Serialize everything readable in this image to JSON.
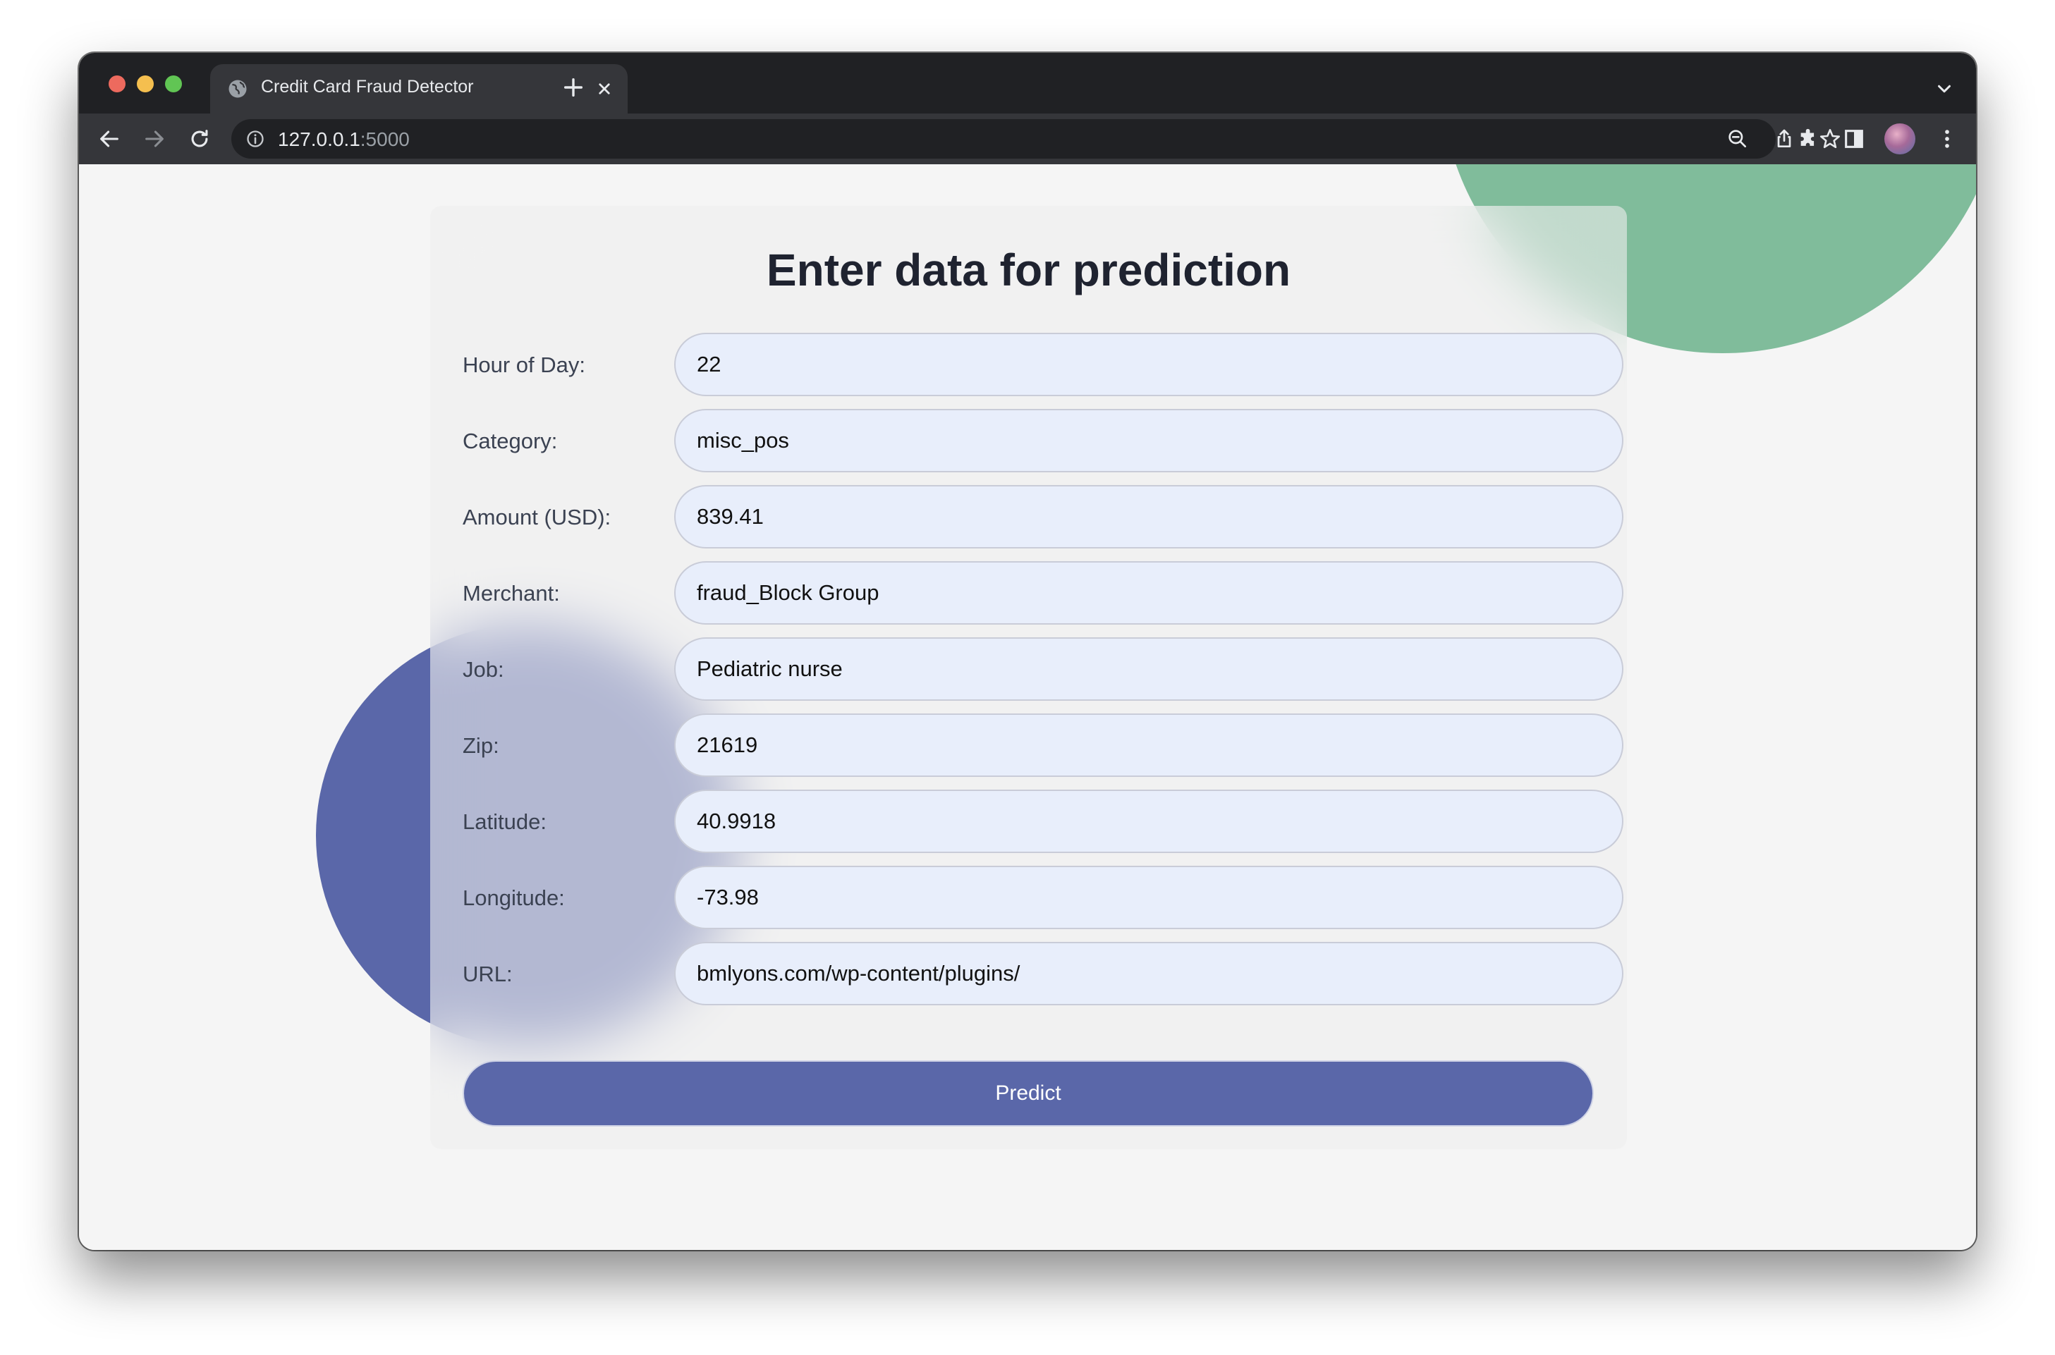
{
  "browser": {
    "tab_title": "Credit Card Fraud Detector",
    "url_host": "127.0.0.1",
    "url_port": ":5000"
  },
  "page": {
    "heading": "Enter data for prediction",
    "fields": [
      {
        "label": "Hour of Day:",
        "value": "22"
      },
      {
        "label": "Category:",
        "value": "misc_pos"
      },
      {
        "label": "Amount (USD):",
        "value": "839.41"
      },
      {
        "label": "Merchant:",
        "value": "fraud_Block Group"
      },
      {
        "label": "Job:",
        "value": "Pediatric nurse"
      },
      {
        "label": "Zip:",
        "value": "21619"
      },
      {
        "label": "Latitude:",
        "value": "40.9918"
      },
      {
        "label": "Longitude:",
        "value": "-73.98"
      },
      {
        "label": "URL:",
        "value": "bmlyons.com/wp-content/plugins/"
      }
    ],
    "submit_label": "Predict"
  },
  "colors": {
    "accent": "#5a67a9",
    "decor_green": "#80bc9b",
    "input_bg": "#e8eefb",
    "card_bg": "#efefef"
  }
}
